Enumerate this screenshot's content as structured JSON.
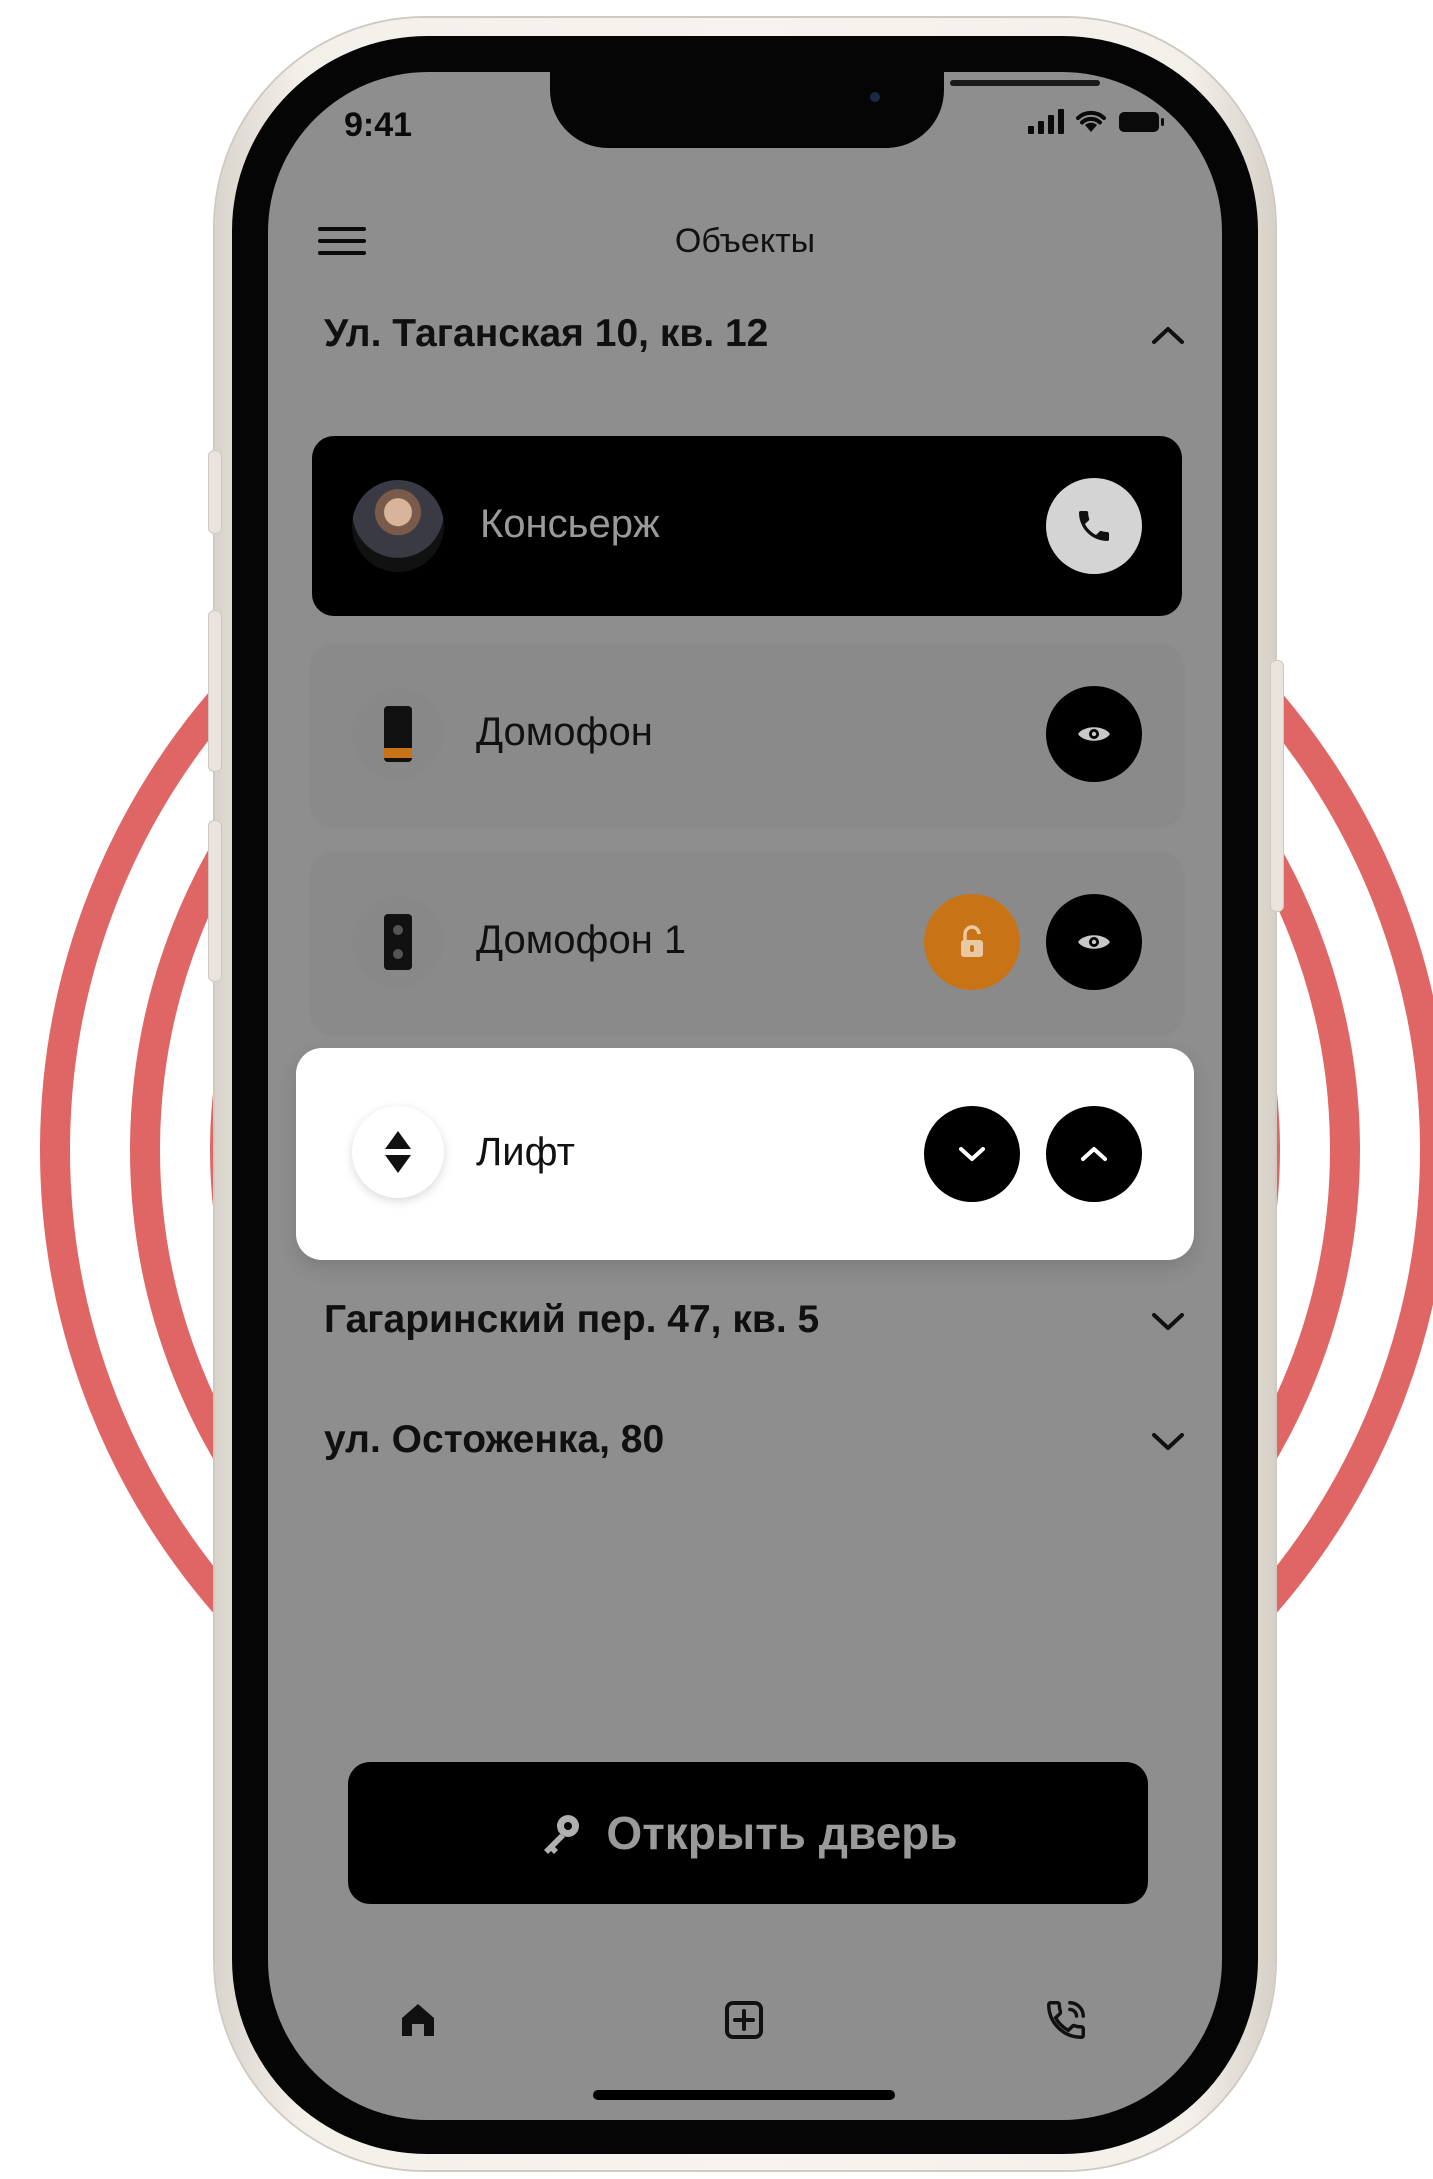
{
  "status": {
    "time": "9:41"
  },
  "header": {
    "title": "Объекты"
  },
  "sections": [
    {
      "title": "Ул. Таганская 10, кв. 12",
      "expanded": true,
      "items": [
        {
          "label": "Консьерж",
          "icon": "avatar",
          "actions": [
            "phone-icon"
          ]
        },
        {
          "label": "Домофон",
          "icon": "intercom-icon",
          "actions": [
            "eye-icon"
          ]
        },
        {
          "label": "Домофон 1",
          "icon": "intercom-icon",
          "actions": [
            "unlock-icon",
            "eye-icon"
          ]
        },
        {
          "label": "Лифт",
          "icon": "updown-icon",
          "actions": [
            "chevron-down-icon",
            "chevron-up-icon"
          ]
        }
      ]
    },
    {
      "title": "Гагаринский пер. 47, кв. 5",
      "expanded": false
    },
    {
      "title": "ул. Остоженка, 80",
      "expanded": false
    }
  ],
  "open_door_button": {
    "label": "Открыть дверь",
    "icon": "key-icon"
  },
  "bottom_nav": [
    "home-icon",
    "add-square-icon",
    "phone-call-icon"
  ],
  "colors": {
    "accent_orange": "#c87416",
    "rings": "#e06666",
    "screen_overlay": "#8e8e8e"
  }
}
